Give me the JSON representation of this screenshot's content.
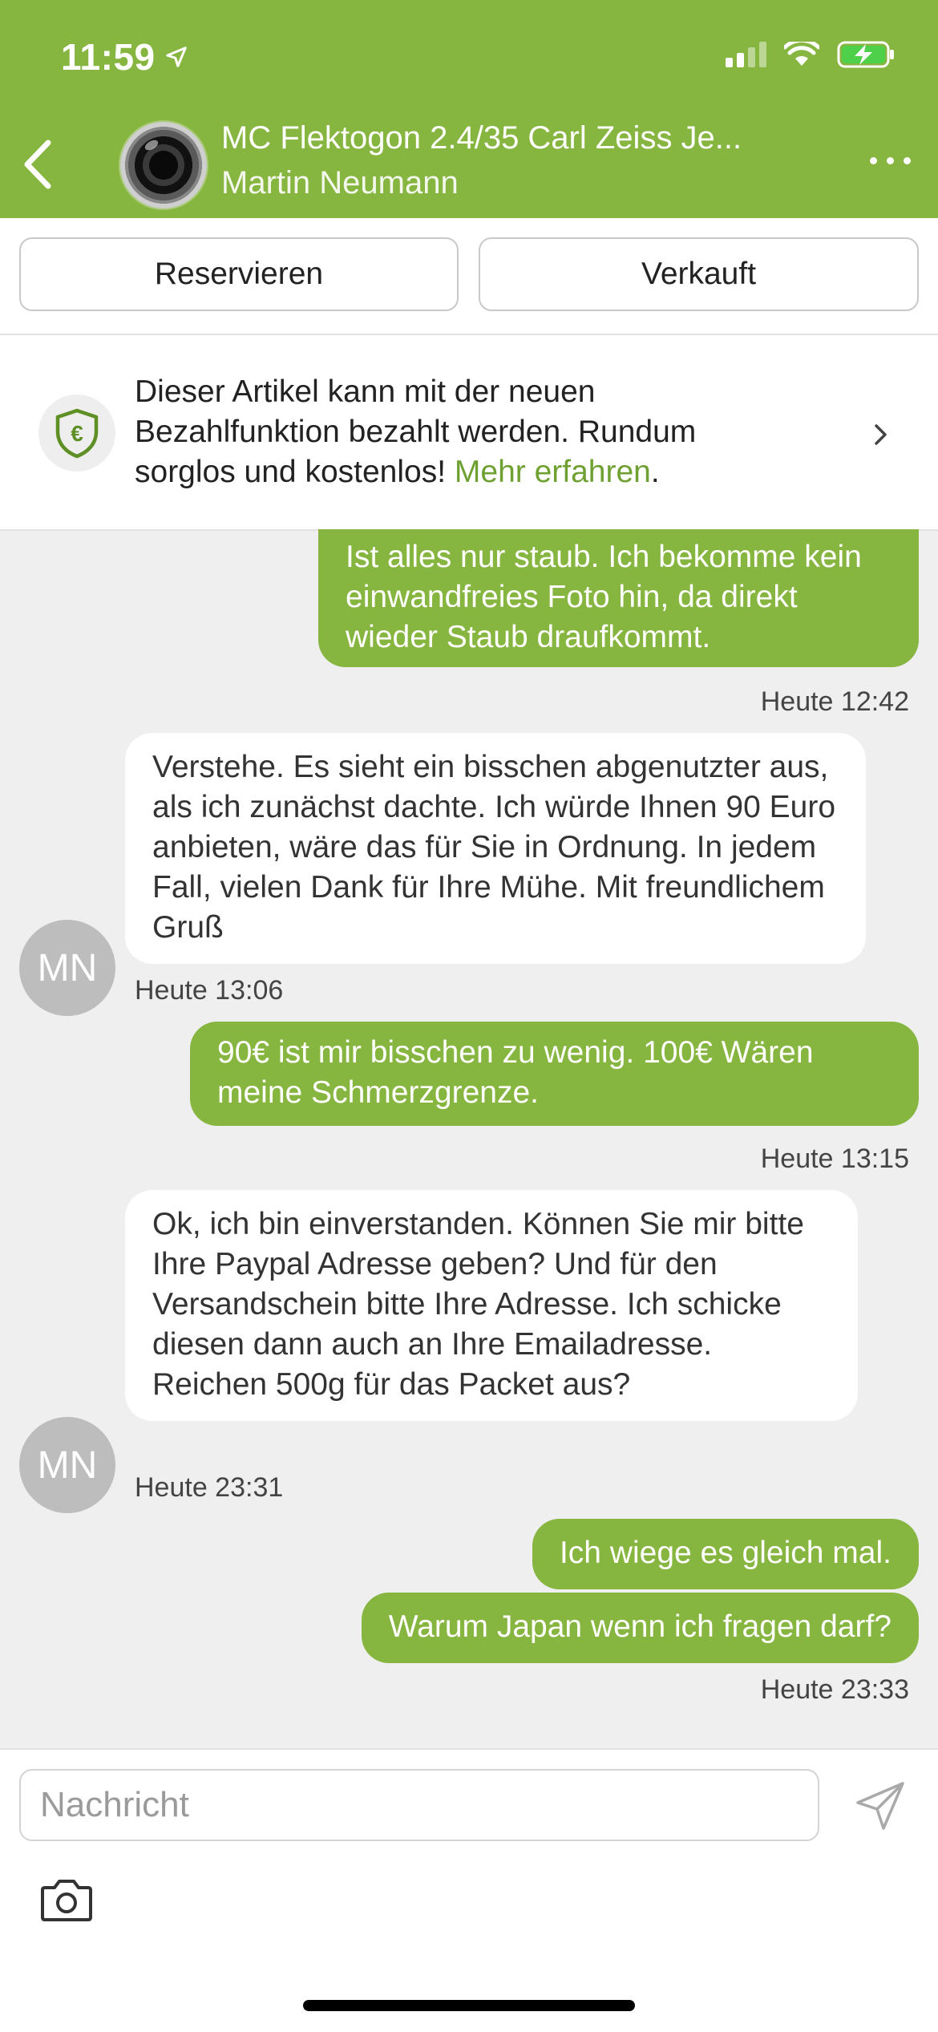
{
  "status_bar": {
    "time": "11:59"
  },
  "header": {
    "title": "MC Flektogon 2.4/35 Carl Zeiss Je...",
    "subtitle": "Martin Neumann",
    "accent_color": "#86b540"
  },
  "actions": {
    "reserve_label": "Reservieren",
    "sold_label": "Verkauft"
  },
  "info_banner": {
    "text": "Dieser Artikel kann mit der neuen Bezahlfunktion bezahlt werden. Rundum sorglos und kostenlos! ",
    "link": "Mehr erfahren",
    "tail": "."
  },
  "messages": [
    {
      "direction": "out",
      "text": "Ist alles nur staub. Ich bekomme kein einwandfreies Foto hin, da direkt wieder Staub draufkommt."
    },
    {
      "direction": "meta",
      "text": "Heute 12:42"
    },
    {
      "direction": "in",
      "text": "Verstehe. Es sieht ein bisschen abgenutzter aus, als ich zunächst dachte. Ich würde Ihnen 90 Euro anbieten, wäre das für Sie in Ordnung. In jedem Fall, vielen Dank für Ihre Mühe. Mit freundlichem Gruß"
    },
    {
      "direction": "avatar",
      "text": "MN"
    },
    {
      "direction": "meta",
      "text": "Heute 13:06"
    },
    {
      "direction": "out",
      "text": "90€ ist mir bisschen zu wenig. 100€ Wären meine Schmerzgrenze."
    },
    {
      "direction": "meta",
      "text": "Heute 13:15"
    },
    {
      "direction": "in",
      "text": "Ok, ich bin einverstanden. Können Sie mir bitte Ihre Paypal Adresse geben? Und für den Versandschein bitte Ihre Adresse. Ich schicke diesen dann auch an Ihre Emailadresse. Reichen 500g für das Packet aus?"
    },
    {
      "direction": "avatar",
      "text": "MN"
    },
    {
      "direction": "meta",
      "text": "Heute 23:31"
    },
    {
      "direction": "out",
      "text": "Ich wiege es gleich mal."
    },
    {
      "direction": "out",
      "text": "Warum Japan wenn ich fragen darf?"
    },
    {
      "direction": "meta",
      "text": "Heute 23:33"
    }
  ],
  "composer": {
    "placeholder": "Nachricht"
  },
  "icons": [
    "back-chevron-icon",
    "location-arrow-icon",
    "signal-icon",
    "wifi-icon",
    "battery-charging-icon",
    "more-dots-icon",
    "euro-shield-icon",
    "chevron-right-icon",
    "send-icon",
    "camera-icon"
  ]
}
